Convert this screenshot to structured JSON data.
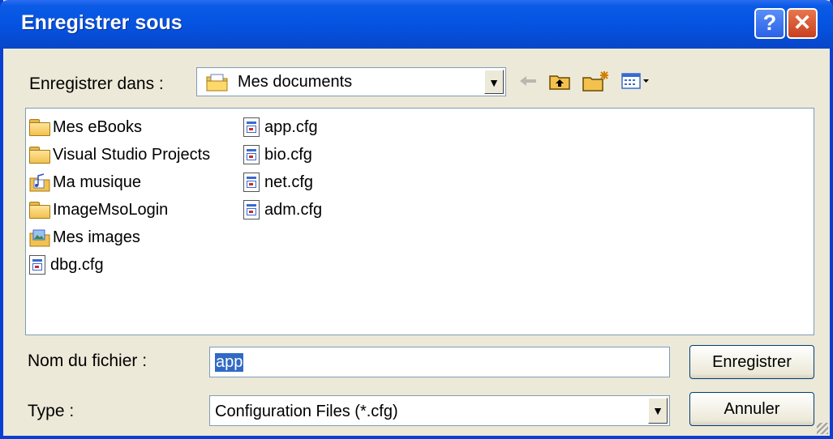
{
  "window": {
    "title": "Enregistrer sous",
    "help_label": "?",
    "close_label": "✕"
  },
  "location": {
    "label": "Enregistrer dans :",
    "current": "Mes documents",
    "icons": [
      "back-arrow-icon",
      "up-folder-icon",
      "new-folder-icon",
      "view-menu-icon"
    ]
  },
  "files": {
    "col1": [
      "Mes eBooks",
      "Visual Studio Projects",
      "Ma musique",
      "ImageMsoLogin",
      "Mes images",
      "dbg.cfg"
    ],
    "col2": [
      "app.cfg",
      "bio.cfg",
      "net.cfg",
      "adm.cfg"
    ]
  },
  "filename": {
    "label": "Nom du fichier :",
    "value": "app"
  },
  "filetype": {
    "label": "Type :",
    "value": "Configuration Files (*.cfg)"
  },
  "buttons": {
    "save": "Enregistrer",
    "cancel": "Annuler"
  }
}
